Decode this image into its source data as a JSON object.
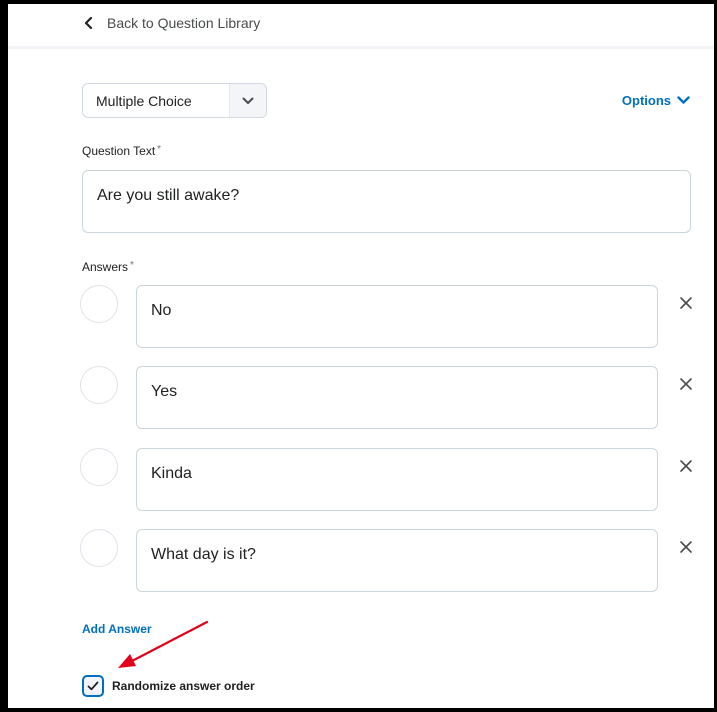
{
  "nav": {
    "back_label": "Back to Question Library"
  },
  "question_type": {
    "selected": "Multiple Choice"
  },
  "options": {
    "label": "Options"
  },
  "question_text": {
    "label": "Question Text",
    "required_mark": "*",
    "value": "Are you still awake?"
  },
  "answers": {
    "label": "Answers",
    "required_mark": "*",
    "items": [
      {
        "value": "No"
      },
      {
        "value": "Yes"
      },
      {
        "value": "Kinda"
      },
      {
        "value": "What day is it?"
      }
    ],
    "remove_icon": "close-icon"
  },
  "add_answer": {
    "label": "Add Answer"
  },
  "randomize": {
    "label": "Randomize answer order",
    "checked": true
  },
  "colors": {
    "accent": "#006fbf",
    "annotation_arrow": "#e3001b",
    "border": "#cdd5dc"
  }
}
